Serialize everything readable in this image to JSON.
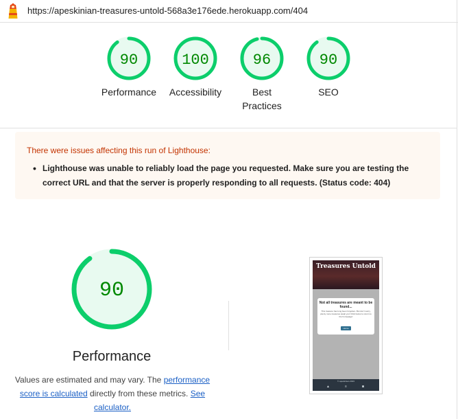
{
  "browser": {
    "url": "https://apeskinian-treasures-untold-568a3e176ede.herokuapp.com/404"
  },
  "gauges": [
    {
      "score": "90",
      "label": "Performance",
      "value": 0.9
    },
    {
      "score": "100",
      "label": "Accessibility",
      "value": 1.0
    },
    {
      "score": "96",
      "label": "Best Practices",
      "value": 0.96
    },
    {
      "score": "90",
      "label": "SEO",
      "value": 0.9
    }
  ],
  "colors": {
    "pass": "#0cce6b",
    "pass_bg": "#e8faf0",
    "pass_text": "#008800",
    "warn_text": "#c33300",
    "link": "#1a5fc5"
  },
  "warning": {
    "title": "There were issues affecting this run of Lighthouse:",
    "item": "Lighthouse was unable to reliably load the page you requested. Make sure you are testing the correct URL and that the server is properly responding to all requests. (Status code: 404)"
  },
  "performance": {
    "score": "90",
    "value": 0.9,
    "title": "Performance",
    "note_1": "Values are estimated and may vary. The",
    "link_1": "performance score is calculated",
    "note_2": "directly from these metrics.",
    "link_2": "See calculator."
  },
  "screenshot": {
    "hero_title": "Treasures Untold",
    "card_title": "Not all treasures are meant to be found...",
    "card_text": "This treasure has long been forgotten. But don't worry, plenty more treasures await you! Click below to return to the homepage!",
    "card_button": "Home",
    "footer_text": "© apeskinian 2023"
  }
}
